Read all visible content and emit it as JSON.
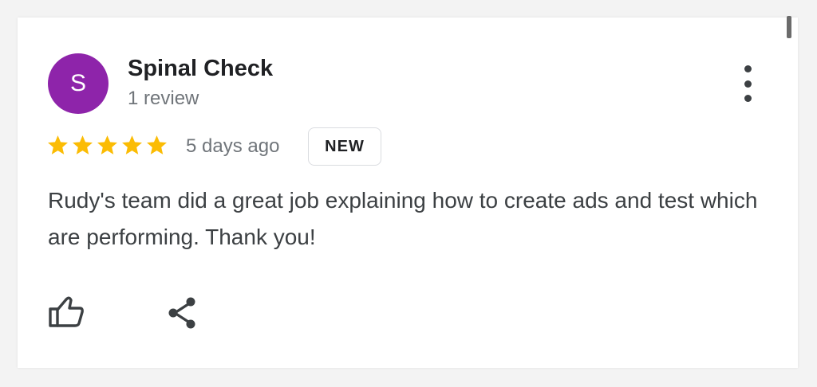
{
  "review": {
    "author": {
      "name": "Spinal Check",
      "initial": "S",
      "review_count": "1 review",
      "avatar_color": "#8e24aa"
    },
    "rating": 5,
    "rating_color": "#fbbc04",
    "date": "5 days ago",
    "badge": "NEW",
    "text": "Rudy's team did a great job explaining how to create ads and test which are performing. Thank you!"
  },
  "actions": {
    "more_icon": "more-vert-icon",
    "like_icon": "thumb-up-icon",
    "share_icon": "share-icon"
  }
}
